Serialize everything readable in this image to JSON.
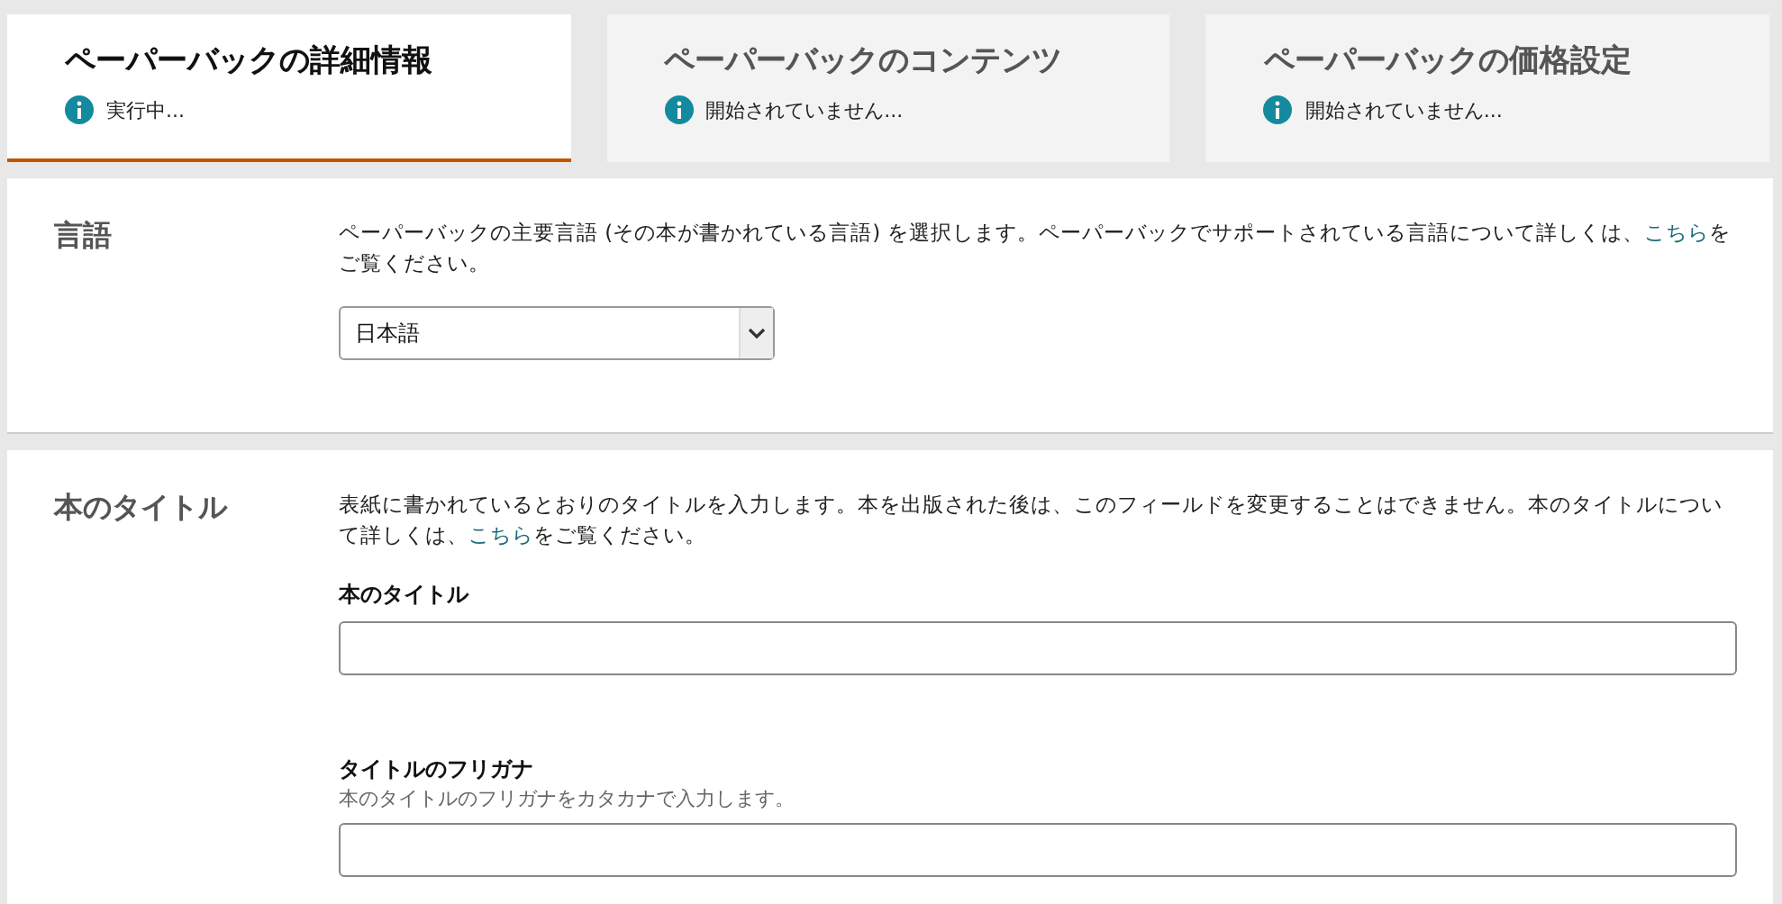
{
  "tabs": [
    {
      "title": "ペーパーバックの詳細情報",
      "status": "実行中...",
      "selected": true
    },
    {
      "title": "ペーパーバックのコンテンツ",
      "status": "開始されていません...",
      "selected": false
    },
    {
      "title": "ペーパーバックの価格設定",
      "status": "開始されていません...",
      "selected": false
    }
  ],
  "sections": [
    {
      "heading": "言語",
      "description": {
        "before": "ペーパーバックの主要言語 (その本が書かれている言語) を選択します。ペーパーバックでサポートされている言語について詳しくは、",
        "link": "こちら",
        "after": "をご覧ください。"
      },
      "fields": [
        {
          "kind": "select",
          "value": "日本語"
        }
      ]
    },
    {
      "heading": "本のタイトル",
      "description": {
        "before": "表紙に書かれているとおりのタイトルを入力します。本を出版された後は、このフィールドを変更することはできません。本のタイトルについて詳しくは、",
        "link": "こちら",
        "after": "をご覧ください。"
      },
      "fields": [
        {
          "kind": "text",
          "label": "本のタイトル"
        },
        {
          "kind": "text",
          "label": "タイトルのフリガナ",
          "hint": "本のタイトルのフリガナをカタカナで入力します。"
        }
      ]
    }
  ]
}
